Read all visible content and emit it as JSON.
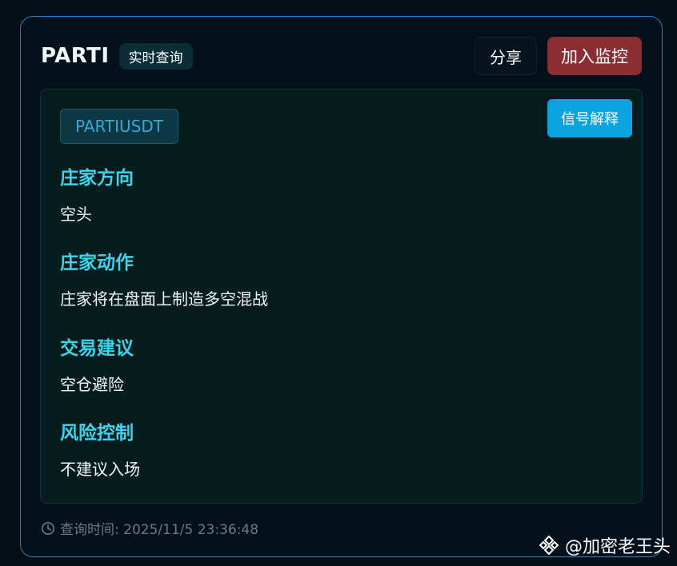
{
  "header": {
    "title": "PARTI",
    "badge": "实时查询",
    "share_label": "分享",
    "monitor_label": "加入监控"
  },
  "panel": {
    "symbol": "PARTIUSDT",
    "explain_label": "信号解释",
    "sections": [
      {
        "title": "庄家方向",
        "value": "空头"
      },
      {
        "title": "庄家动作",
        "value": "庄家将在盘面上制造多空混战"
      },
      {
        "title": "交易建议",
        "value": "空仓避险"
      },
      {
        "title": "风险控制",
        "value": "不建议入场"
      }
    ]
  },
  "footer": {
    "query_time": "查询时间: 2025/11/5 23:36:48"
  },
  "watermark": {
    "text": "@加密老王头"
  },
  "icons": {
    "clock": "clock-icon",
    "binance": "binance-logo-icon"
  },
  "colors": {
    "accent_cyan": "#3fd2ea",
    "monitor_red": "#8a2e33",
    "explain_blue": "#0aa3df",
    "card_border": "#2a7fc1"
  }
}
